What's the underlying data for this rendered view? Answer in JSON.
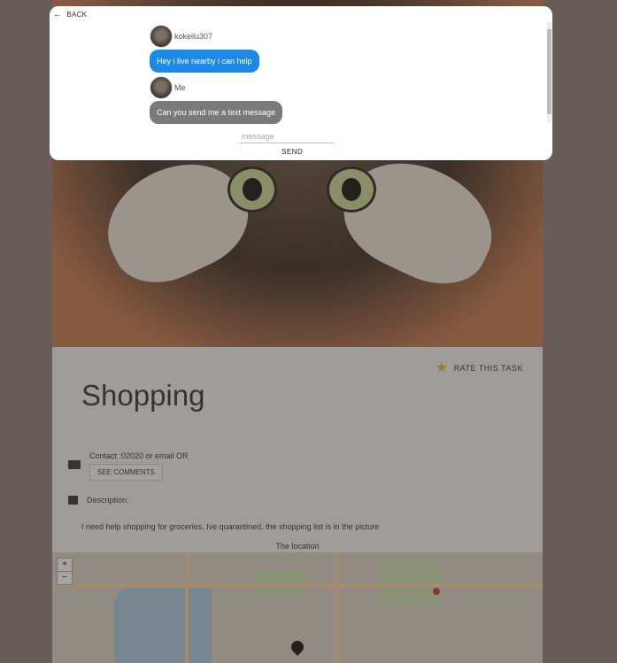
{
  "dialog": {
    "back_label": "BACK",
    "messages": [
      {
        "user": "kokeilu307",
        "text": "Hey i live nearby i can help"
      },
      {
        "user": "Me",
        "text": "Can you send me a text message"
      }
    ],
    "input_placeholder": "message",
    "input_value": "",
    "send_label": "SEND"
  },
  "task": {
    "rate_label": "RATE THIS TASK",
    "title": "Shopping",
    "contact_text": "Contact :02020 or email OR",
    "see_comments_label": "SEE COMMENTS",
    "description_label": "Description:",
    "description_text": "I need help shopping for groceries. Ive quarantined. the shopping list is in the picture",
    "location_label": "The location"
  },
  "map": {
    "zoom_in": "+",
    "zoom_out": "−"
  },
  "colors": {
    "accent_blue": "#1e88e5",
    "bubble_grey": "#7a7a7a",
    "star": "#d6c02a"
  }
}
